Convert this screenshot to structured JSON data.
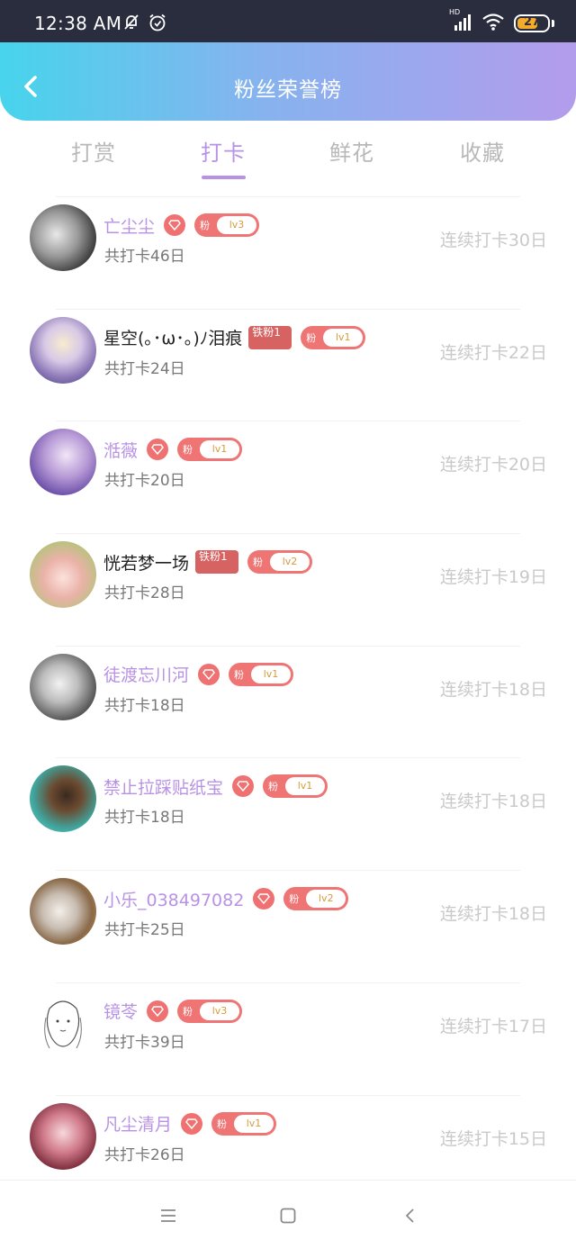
{
  "status": {
    "time": "12:38 AM",
    "battery": "27",
    "network": "HD",
    "icons": [
      "muted-bell-icon",
      "alarm-icon",
      "signal-icon",
      "wifi-icon",
      "battery-icon"
    ]
  },
  "header": {
    "title": "粉丝荣誉榜",
    "back_icon": "chevron-left-icon"
  },
  "tabs": [
    {
      "label": "打赏",
      "active": false
    },
    {
      "label": "打卡",
      "active": true
    },
    {
      "label": "鲜花",
      "active": false
    },
    {
      "label": "收藏",
      "active": false
    }
  ],
  "list": [
    {
      "name": "亡尘尘",
      "highlight": true,
      "iron_badge": "",
      "fan_label": "粉",
      "level": "lv3",
      "total": "共打卡46日",
      "streak": "连续打卡30日"
    },
    {
      "name": "星空(｡･ω･｡)ﾉ泪痕",
      "highlight": false,
      "iron_badge": "铁粉1",
      "fan_label": "粉",
      "level": "lv1",
      "total": "共打卡24日",
      "streak": "连续打卡22日"
    },
    {
      "name": "湉薇",
      "highlight": true,
      "iron_badge": "",
      "fan_label": "粉",
      "level": "lv1",
      "total": "共打卡20日",
      "streak": "连续打卡20日"
    },
    {
      "name": "恍若梦一场",
      "highlight": false,
      "iron_badge": "铁粉1",
      "fan_label": "粉",
      "level": "lv2",
      "total": "共打卡28日",
      "streak": "连续打卡19日"
    },
    {
      "name": "徒渡忘川河",
      "highlight": true,
      "iron_badge": "",
      "fan_label": "粉",
      "level": "lv1",
      "total": "共打卡18日",
      "streak": "连续打卡18日"
    },
    {
      "name": "禁止拉踩贴纸宝",
      "highlight": true,
      "iron_badge": "",
      "fan_label": "粉",
      "level": "lv1",
      "total": "共打卡18日",
      "streak": "连续打卡18日"
    },
    {
      "name": "小乐_038497082",
      "highlight": true,
      "iron_badge": "",
      "fan_label": "粉",
      "level": "lv2",
      "total": "共打卡25日",
      "streak": "连续打卡18日"
    },
    {
      "name": "镜苓",
      "highlight": true,
      "iron_badge": "",
      "fan_label": "粉",
      "level": "lv3",
      "total": "共打卡39日",
      "streak": "连续打卡17日"
    },
    {
      "name": "凡尘清月",
      "highlight": true,
      "iron_badge": "",
      "fan_label": "粉",
      "level": "lv1",
      "total": "共打卡26日",
      "streak": "连续打卡15日"
    }
  ],
  "navbar": {
    "icons": [
      "menu-icon",
      "home-square-icon",
      "back-triangle-icon"
    ]
  }
}
